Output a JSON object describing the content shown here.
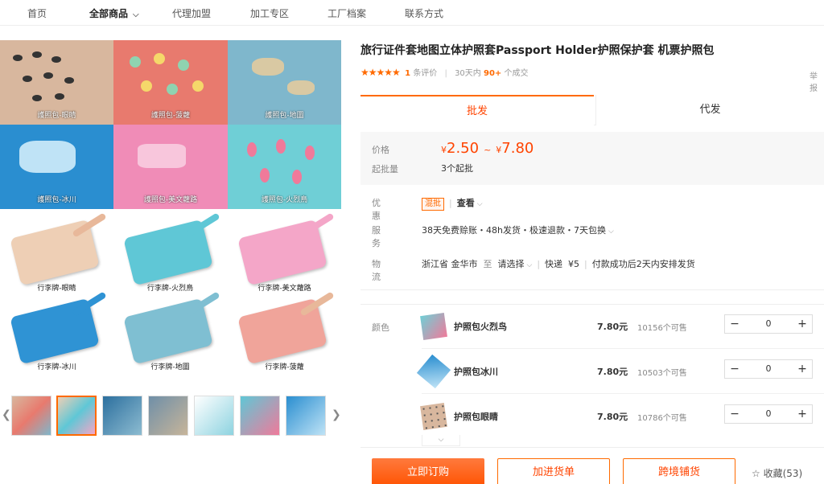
{
  "nav": {
    "items": [
      "首页",
      "全部商品",
      "代理加盟",
      "加工专区",
      "工厂档案",
      "联系方式"
    ]
  },
  "gallery": {
    "main_captions": [
      "護照包-眼睛",
      "護照包-菠蘿",
      "護照包-地圖",
      "護照包-冰川",
      "護照包-美文蘿路",
      "護照包-火烈鳥"
    ],
    "luggage_captions": [
      "行李牌-眼睛",
      "行李牌-火烈鳥",
      "行李牌-美文蘿路",
      "行李牌-冰川",
      "行李牌-地圖",
      "行李牌-菠蘿"
    ]
  },
  "product": {
    "title": "旅行证件套地图立体护照套Passport Holder护照保护套 机票护照包",
    "stars": "★★★★★",
    "review_count": "1",
    "review_label": "条评价",
    "sales_prefix": "30天内",
    "sales_count": "90+",
    "sales_suffix": "个成交",
    "report": "举报"
  },
  "tabs": {
    "wholesale": "批发",
    "dropship": "代发"
  },
  "pricing": {
    "price_label": "价格",
    "currency": "¥",
    "price_min": "2.50",
    "price_sep": "~",
    "price_max": "7.80",
    "moq_label": "起批量",
    "moq_value": "3个起批"
  },
  "info": {
    "discount_label": "优惠",
    "discount_badge": "混批",
    "discount_view": "查看",
    "service_label": "服务",
    "service_value": "38天免费赊账・48h发货・极速退款・7天包换",
    "logistics_label": "物流",
    "origin": "浙江省 金华市",
    "to": "至",
    "dest": "请选择",
    "express": "快递",
    "fee": "¥5",
    "shipping_note": "付款成功后2天内安排发货"
  },
  "sku": {
    "label": "颜色",
    "items": [
      {
        "name": "护照包火烈鸟",
        "price": "7.80元",
        "stock": "10156个可售",
        "qty": "0"
      },
      {
        "name": "护照包冰川",
        "price": "7.80元",
        "stock": "10503个可售",
        "qty": "0"
      },
      {
        "name": "护照包眼睛",
        "price": "7.80元",
        "stock": "10786个可售",
        "qty": "0"
      }
    ]
  },
  "actions": {
    "buy": "立即订购",
    "cart": "加进货单",
    "cross_border": "跨境铺货",
    "favorite": "收藏(53)"
  },
  "colors": {
    "accent": "#ff6a00",
    "price": "#ff4400"
  }
}
